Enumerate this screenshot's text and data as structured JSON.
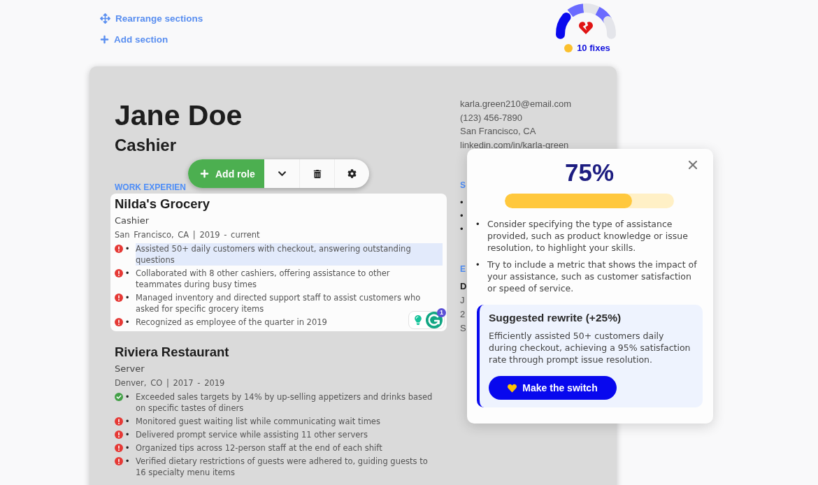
{
  "top_actions": {
    "rearrange": "Rearrange sections",
    "add_section": "Add section"
  },
  "score_gauge": {
    "segments": [
      {
        "color": "#0a0aee"
      },
      {
        "color": "#6b6bff"
      },
      {
        "color": "#e4e5ea"
      },
      {
        "color": "#6b6bff"
      },
      {
        "color": "#e4e5ea"
      }
    ],
    "fixes": "10 fixes"
  },
  "resume": {
    "name": "Jane Doe",
    "title": "Cashier",
    "contact": [
      "karla.green210@email.com",
      "(123) 456-7890",
      "San Francisco, CA",
      "linkedin.com/in/karla-green"
    ],
    "work_experience": {
      "heading": "WORK EXPERIEN",
      "jobs": [
        {
          "company": "Nilda's Grocery",
          "role": "Cashier",
          "meta": "San Francisco, CA | 2019 - current",
          "selected": true,
          "bullets": [
            {
              "flagged": true,
              "marker": "•",
              "text": "Assisted 50+ daily customers with checkout, answering outstanding questions",
              "selected": true
            },
            {
              "flagged": true,
              "marker": "•",
              "text": "Collaborated with 8 other cashiers, offering assistance to other teammates during busy times",
              "selected": false
            },
            {
              "flagged": true,
              "marker": "•",
              "text": "Managed inventory and directed support staff to assist customers who asked for specific grocery items",
              "selected": false
            },
            {
              "flagged": true,
              "marker": "•",
              "text": "Recognized as employee of the quarter in 2019",
              "selected": false
            }
          ]
        },
        {
          "company": "Riviera Restaurant",
          "role": "Server",
          "meta": "Denver, CO | 2017 - 2019",
          "selected": false,
          "bullets": [
            {
              "flagged": false,
              "marker": "•",
              "text": "Exceeded sales targets by 14% by up-selling appetizers and drinks based on specific tastes of diners",
              "selected": false
            },
            {
              "flagged": true,
              "marker": "•",
              "text": "Monitored guest waiting list while communicating wait times",
              "selected": false
            },
            {
              "flagged": true,
              "marker": "•",
              "text": "Delivered prompt service while assisting 11 other servers",
              "selected": false
            },
            {
              "flagged": true,
              "marker": "•",
              "text": "Organized tips across 12-person staff at the end of each shift",
              "selected": false
            },
            {
              "flagged": true,
              "marker": "•",
              "text": "Verified dietary restrictions of guests were adhered to, guiding guests to 16 specialty menu items",
              "selected": false
            }
          ]
        }
      ]
    },
    "right_sections": [
      {
        "heading": "S",
        "markers": [
          "•",
          "•",
          "•"
        ]
      },
      {
        "heading": "E",
        "entry_title": "D",
        "entry_lines": [
          "J",
          "2",
          "S"
        ]
      }
    ]
  },
  "role_toolbar": {
    "add_label": "Add role"
  },
  "assistant_widget": {
    "count": "1"
  },
  "feedback_popup": {
    "score": "75%",
    "level": 0.75,
    "tips": [
      {
        "marker": "•",
        "text": "Consider specifying the type of assistance provided, such as product knowledge or issue resolution, to highlight your skills."
      },
      {
        "marker": "•",
        "text": "Try to include a metric that shows the impact of your assistance, such as customer satisfaction or speed of service."
      }
    ],
    "rewrite": {
      "title": "Suggested rewrite (+25%)",
      "text": "Efficiently assisted 50+ customers daily during checkout, achieving a 95% satisfaction rate through prompt issue resolution.",
      "button": "Make the switch"
    }
  }
}
